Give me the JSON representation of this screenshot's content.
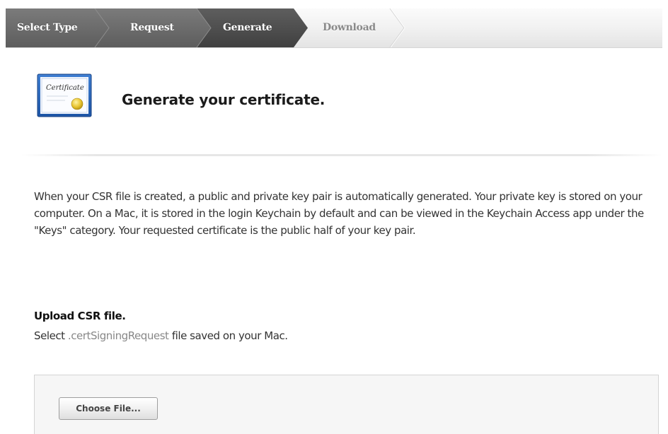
{
  "steps": [
    {
      "label": "Select Type",
      "state": "done"
    },
    {
      "label": "Request",
      "state": "done"
    },
    {
      "label": "Generate",
      "state": "current"
    },
    {
      "label": "Download",
      "state": "todo"
    }
  ],
  "header": {
    "icon_text": "Certificate",
    "title": "Generate your certificate."
  },
  "description": "When your CSR file is created, a public and private key pair is automatically generated. Your private key is stored on your computer. On a Mac, it is stored in the login Keychain by default and can be viewed in the Keychain Access app under the \"Keys\" category. Your requested certificate is the public half of your key pair.",
  "upload": {
    "title": "Upload CSR file.",
    "hint_prefix": "Select ",
    "hint_ext": ".certSigningRequest",
    "hint_suffix": " file saved on your Mac.",
    "button_label": "Choose File..."
  },
  "colors": {
    "step_done": "#6a6a6a",
    "step_current": "#4e4e4e",
    "step_text_todo": "#8a8a8a",
    "seal": "#e6c530"
  }
}
